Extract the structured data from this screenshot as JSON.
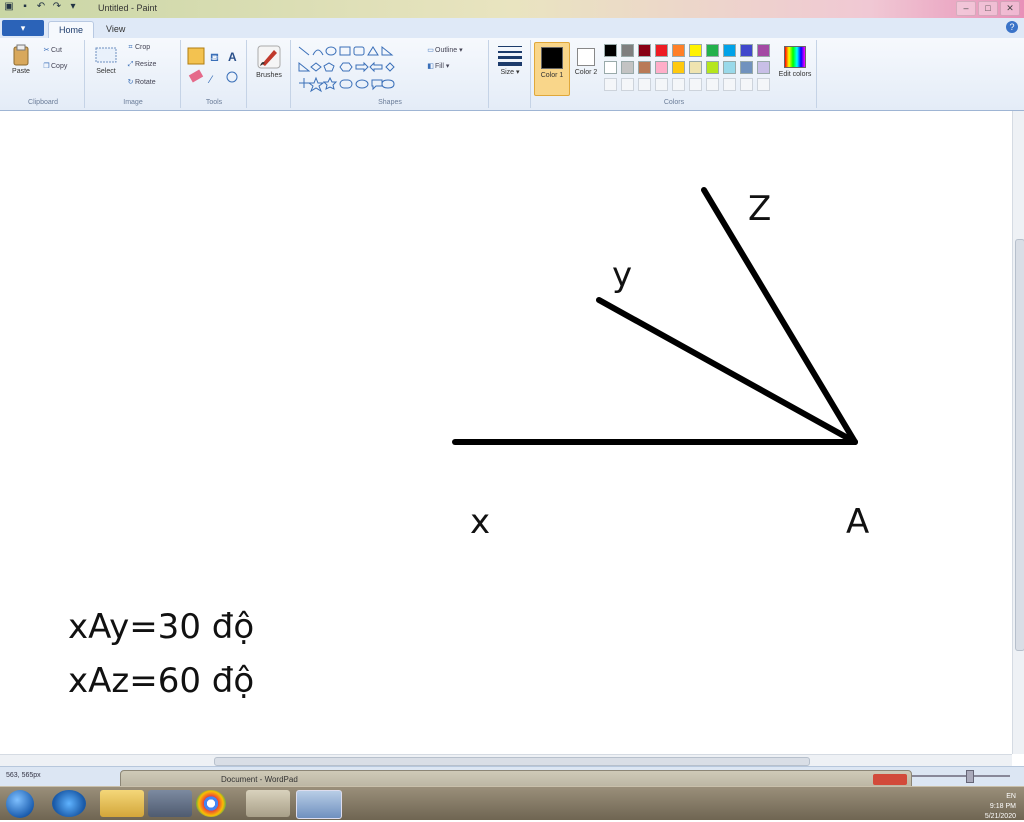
{
  "window": {
    "title": "Untitled - Paint"
  },
  "titlebar": {
    "qat_icons": [
      "save-icon",
      "undo-icon",
      "redo-icon",
      "dropdown-icon"
    ],
    "min": "–",
    "max": "□",
    "close": "✕"
  },
  "tabs": {
    "file": "▾",
    "home": "Home",
    "view": "View",
    "help": "?"
  },
  "ribbon": {
    "clipboard": {
      "label": "Clipboard",
      "paste": "Paste",
      "cut": "Cut",
      "copy": "Copy"
    },
    "image": {
      "label": "Image",
      "select": "Select",
      "crop": "Crop",
      "resize": "Resize",
      "rotate": "Rotate"
    },
    "tools": {
      "label": "Tools"
    },
    "brushes": {
      "label": "Brushes"
    },
    "shapes": {
      "label": "Shapes",
      "outline": "Outline",
      "fill": "Fill"
    },
    "size": {
      "label": "Size"
    },
    "colors": {
      "label": "Colors",
      "color1": "Color 1",
      "color2": "Color 2",
      "edit": "Edit colors",
      "palette_row1": [
        "#000000",
        "#7f7f7f",
        "#880015",
        "#ed1c24",
        "#ff7f27",
        "#fff200",
        "#22b14c",
        "#00a2e8",
        "#3f48cc",
        "#a349a4"
      ],
      "palette_row2": [
        "#ffffff",
        "#c3c3c3",
        "#b97a57",
        "#ffaec9",
        "#ffc90e",
        "#efe4b0",
        "#b5e61d",
        "#99d9ea",
        "#7092be",
        "#c8bfe7"
      ]
    }
  },
  "drawing": {
    "labels": {
      "z": "Z",
      "y": "y",
      "x": "x",
      "a": "A"
    },
    "notes": [
      "xAy=30 độ",
      "xAz=60 độ"
    ]
  },
  "statusbar": {
    "coords": "563, 565px"
  },
  "preview": {
    "title": "Document - WordPad"
  },
  "taskbar": {
    "time": "9:18 PM",
    "date": "5/21/2020",
    "lang": "EN"
  }
}
